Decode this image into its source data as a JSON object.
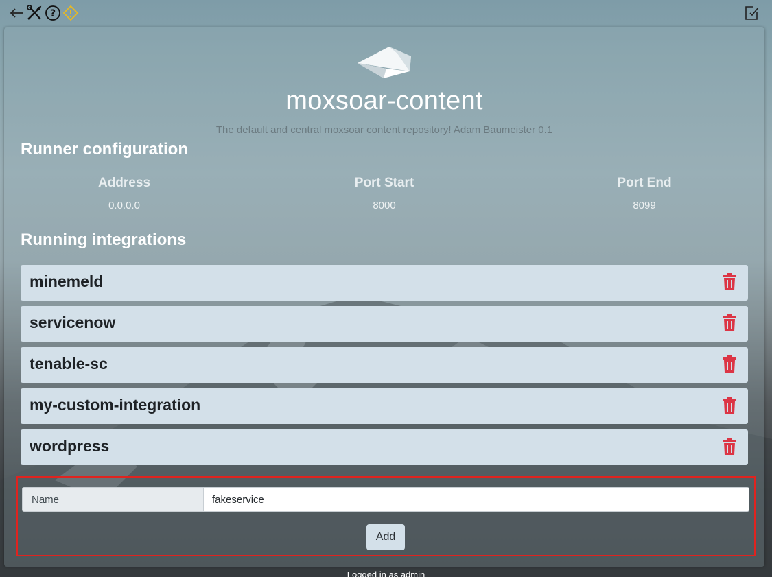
{
  "app": {
    "title": "moxsoar-content",
    "description": "The default and central moxsoar content repository! Adam Baumeister 0.1"
  },
  "toolbar": {
    "icons": [
      "back-arrow-icon",
      "tools-icon",
      "help-icon",
      "warning-icon",
      "edit-note-icon"
    ],
    "warning_color": "#e8b923"
  },
  "runner": {
    "heading": "Runner configuration",
    "columns": [
      {
        "label": "Address",
        "value": "0.0.0.0"
      },
      {
        "label": "Port Start",
        "value": "8000"
      },
      {
        "label": "Port End",
        "value": "8099"
      }
    ]
  },
  "integrations": {
    "heading": "Running integrations",
    "items": [
      {
        "name": "minemeld"
      },
      {
        "name": "servicenow"
      },
      {
        "name": "tenable-sc"
      },
      {
        "name": "my-custom-integration"
      },
      {
        "name": "wordpress"
      }
    ],
    "delete_icon": "trash-icon",
    "delete_color": "#dc3545"
  },
  "add_form": {
    "name_label": "Name",
    "name_value": "fakeservice",
    "add_label": "Add",
    "highlight_color": "#e0231f"
  },
  "footer": {
    "text": "Logged in as admin"
  }
}
